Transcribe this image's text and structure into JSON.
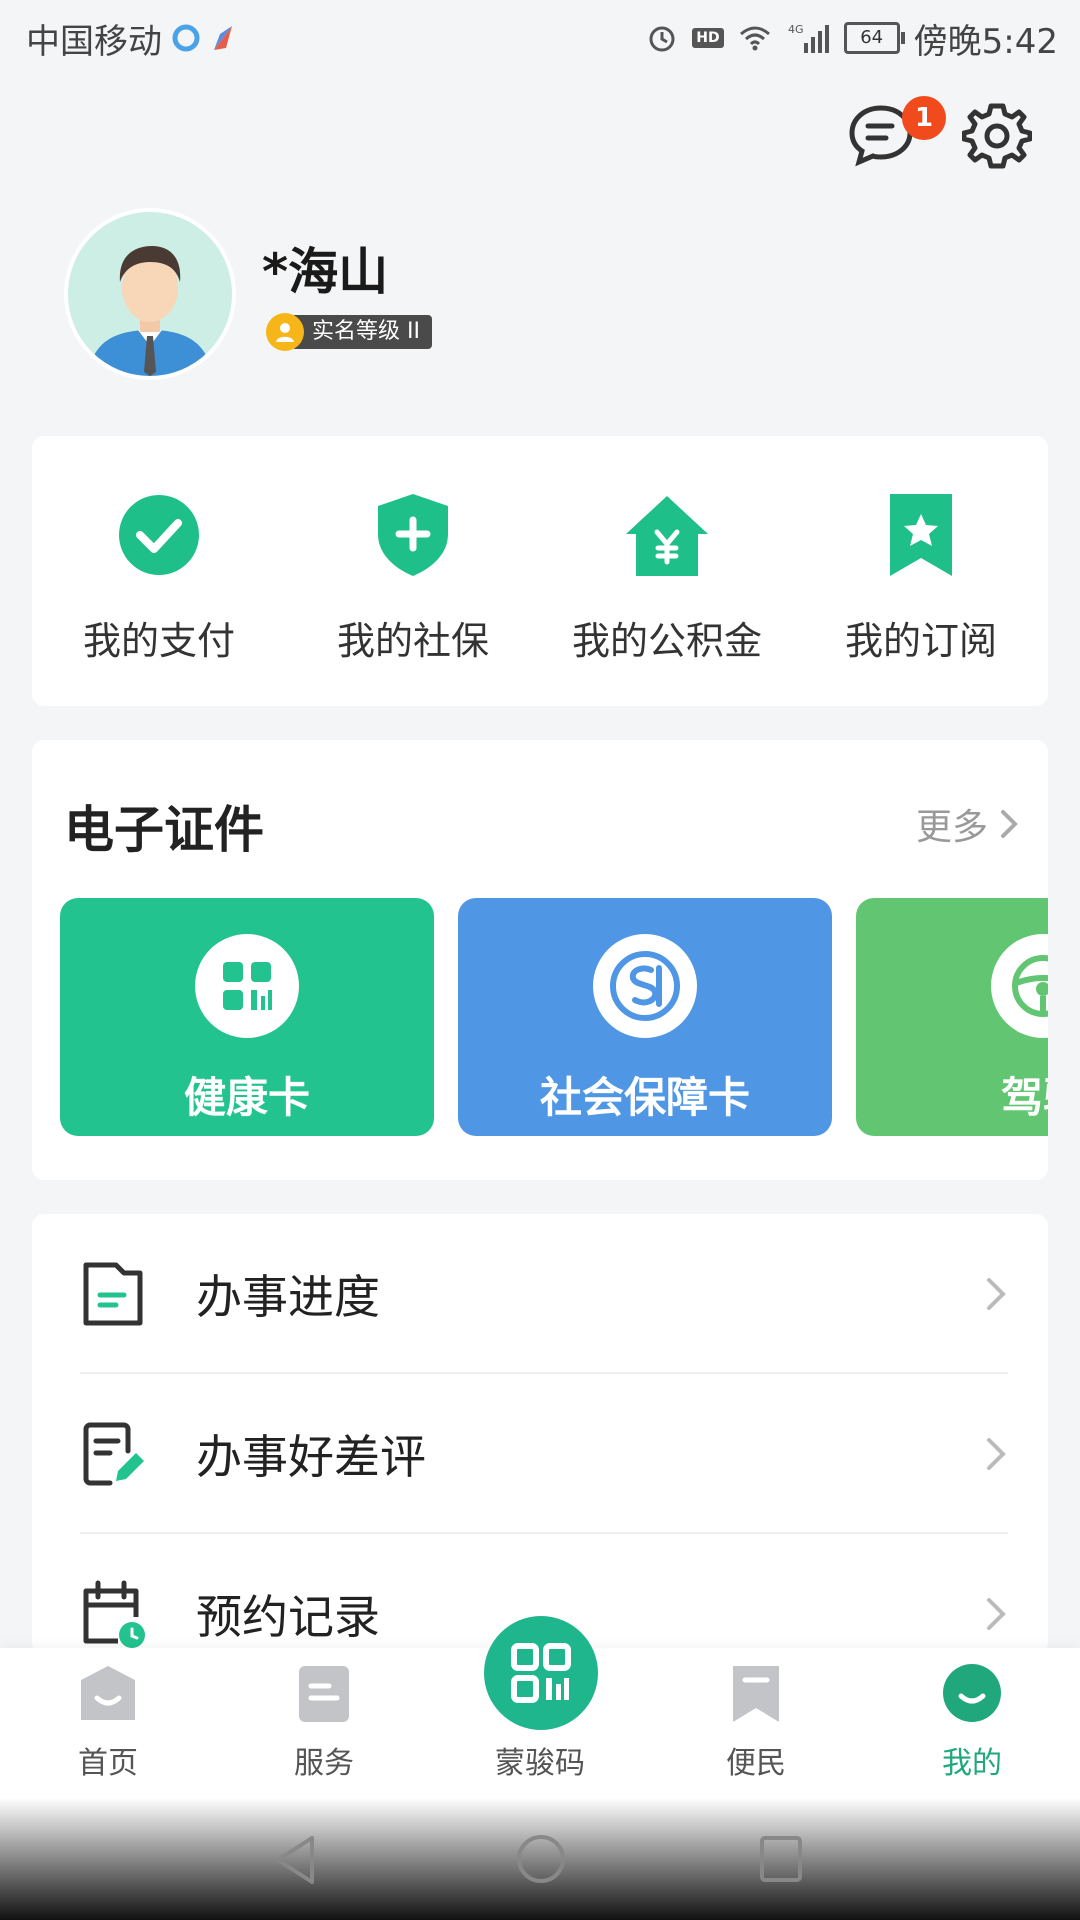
{
  "status_bar": {
    "carrier": "中国移动",
    "battery": "64",
    "time": "傍晚5:42",
    "hd": "HD",
    "network": "4G"
  },
  "header": {
    "message_badge_count": "1"
  },
  "profile": {
    "name": "*海山",
    "verify_level": "实名等级 II"
  },
  "quick_actions": [
    {
      "label": "我的支付",
      "icon": "check-circle-icon"
    },
    {
      "label": "我的社保",
      "icon": "shield-plus-icon"
    },
    {
      "label": "我的公积金",
      "icon": "house-yuan-icon"
    },
    {
      "label": "我的订阅",
      "icon": "bookmark-star-icon"
    }
  ],
  "certificates": {
    "title": "电子证件",
    "more": "更多",
    "cards": [
      {
        "name": "健康卡",
        "color": "#22c38f"
      },
      {
        "name": "社会保障卡",
        "color": "#4f96e4"
      },
      {
        "name": "驾驶",
        "color": "#62c572"
      }
    ]
  },
  "menu": [
    {
      "label": "办事进度",
      "icon": "document-icon"
    },
    {
      "label": "办事好差评",
      "icon": "edit-review-icon"
    },
    {
      "label": "预约记录",
      "icon": "calendar-clock-icon"
    }
  ],
  "bottom_nav": {
    "items": [
      "首页",
      "服务",
      "蒙骏码",
      "便民",
      "我的"
    ],
    "active": "我的",
    "accent": "#20a87c"
  }
}
